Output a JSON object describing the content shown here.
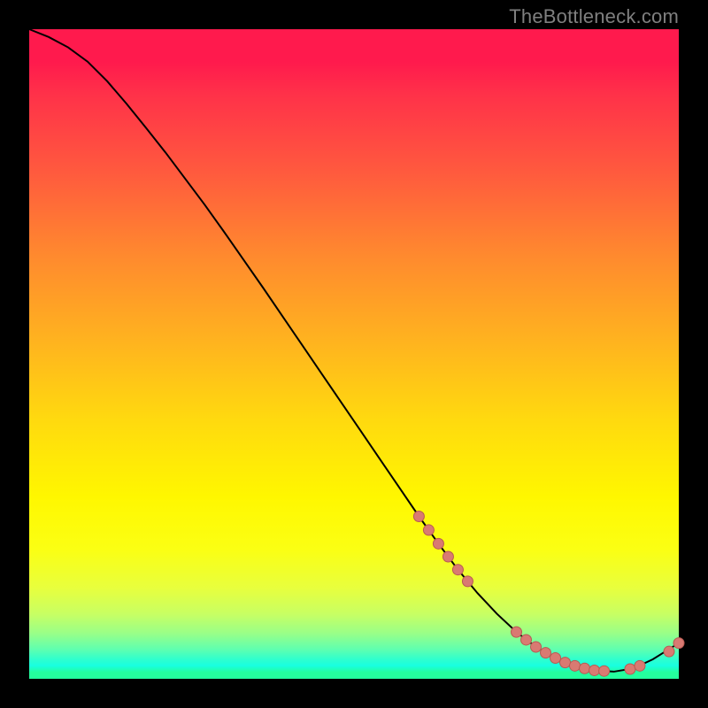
{
  "brand": "TheBottleneck.com",
  "colors": {
    "curve": "#000000",
    "marker_fill": "#d97a72",
    "marker_stroke": "#b85a52",
    "bg": "#000000"
  },
  "chart_data": {
    "type": "line",
    "title": "",
    "xlabel": "",
    "ylabel": "",
    "xlim": [
      0,
      100
    ],
    "ylim": [
      0,
      100
    ],
    "grid": false,
    "legend": false,
    "x": [
      0,
      3,
      6,
      9,
      12,
      15,
      18,
      21,
      24,
      27,
      30,
      33,
      36,
      39,
      42,
      45,
      48,
      51,
      54,
      57,
      60,
      63,
      66,
      69,
      72,
      75,
      78,
      81,
      84,
      87,
      90,
      93,
      96,
      100
    ],
    "values": [
      100,
      98.8,
      97.2,
      95.0,
      92.0,
      88.5,
      84.8,
      81.0,
      77.0,
      73.0,
      68.8,
      64.5,
      60.2,
      55.8,
      51.4,
      47.0,
      42.6,
      38.2,
      33.8,
      29.4,
      25.0,
      20.8,
      16.8,
      13.2,
      10.0,
      7.2,
      4.9,
      3.2,
      2.0,
      1.3,
      1.1,
      1.6,
      3.0,
      5.5
    ],
    "markers": [
      {
        "x": 60.0,
        "y": 25.0
      },
      {
        "x": 61.5,
        "y": 22.9
      },
      {
        "x": 63.0,
        "y": 20.8
      },
      {
        "x": 64.5,
        "y": 18.8
      },
      {
        "x": 66.0,
        "y": 16.8
      },
      {
        "x": 67.5,
        "y": 15.0
      },
      {
        "x": 75.0,
        "y": 7.2
      },
      {
        "x": 76.5,
        "y": 6.0
      },
      {
        "x": 78.0,
        "y": 4.9
      },
      {
        "x": 79.5,
        "y": 4.0
      },
      {
        "x": 81.0,
        "y": 3.2
      },
      {
        "x": 82.5,
        "y": 2.5
      },
      {
        "x": 84.0,
        "y": 2.0
      },
      {
        "x": 85.5,
        "y": 1.6
      },
      {
        "x": 87.0,
        "y": 1.3
      },
      {
        "x": 88.5,
        "y": 1.2
      },
      {
        "x": 92.5,
        "y": 1.5
      },
      {
        "x": 94.0,
        "y": 2.0
      },
      {
        "x": 100.0,
        "y": 5.5
      },
      {
        "x": 98.5,
        "y": 4.2
      }
    ]
  }
}
